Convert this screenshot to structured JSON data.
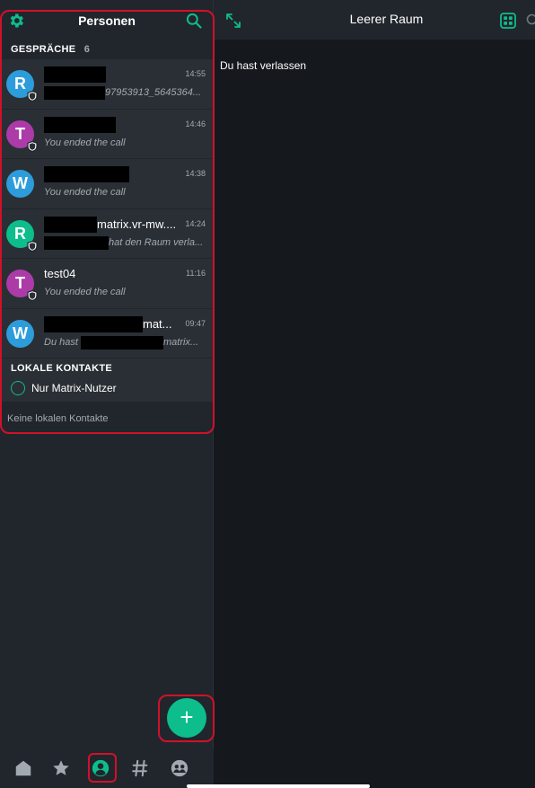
{
  "sidebar": {
    "title": "Personen",
    "section_label": "GESPRÄCHE",
    "section_count": "6",
    "rooms": [
      {
        "avatar_letter": "R",
        "avatar_color": "#2d9cdb",
        "name": "",
        "time": "14:55",
        "subtitle": "97953913_5645364..."
      },
      {
        "avatar_letter": "T",
        "avatar_color": "#ac3ba8",
        "name": "",
        "time": "14:46",
        "subtitle": "You ended the call"
      },
      {
        "avatar_letter": "W",
        "avatar_color": "#2d9cdb",
        "name": "",
        "time": "14:38",
        "subtitle": "You ended the call"
      },
      {
        "avatar_letter": "R",
        "avatar_color": "#0dbd8b",
        "name": "matrix.vr-mw....",
        "time": "14:24",
        "subtitle": "hat den Raum verla..."
      },
      {
        "avatar_letter": "T",
        "avatar_color": "#ac3ba8",
        "name": "test04",
        "time": "11:16",
        "subtitle": "You ended the call"
      },
      {
        "avatar_letter": "W",
        "avatar_color": "#2d9cdb",
        "name": "mat...",
        "time": "09:47",
        "subtitle_prefix": "Du hast",
        "subtitle": "matrix..."
      }
    ],
    "local_contacts_label": "LOKALE KONTAKTE",
    "matrix_only_label": "Nur Matrix-Nutzer",
    "empty_note": "Keine lokalen Kontakte",
    "fab_label": "+",
    "tabs": [
      "home-icon",
      "favourites-star-icon",
      "people-icon",
      "rooms-hash-icon",
      "communities-icon"
    ]
  },
  "main": {
    "title": "Leerer Raum",
    "message": "Du hast verlassen"
  },
  "colors": {
    "accent": "#0dbd8b",
    "highlight": "#d0112b",
    "background": "#15191e",
    "panel": "#21262c",
    "row": "#2a2f35"
  }
}
